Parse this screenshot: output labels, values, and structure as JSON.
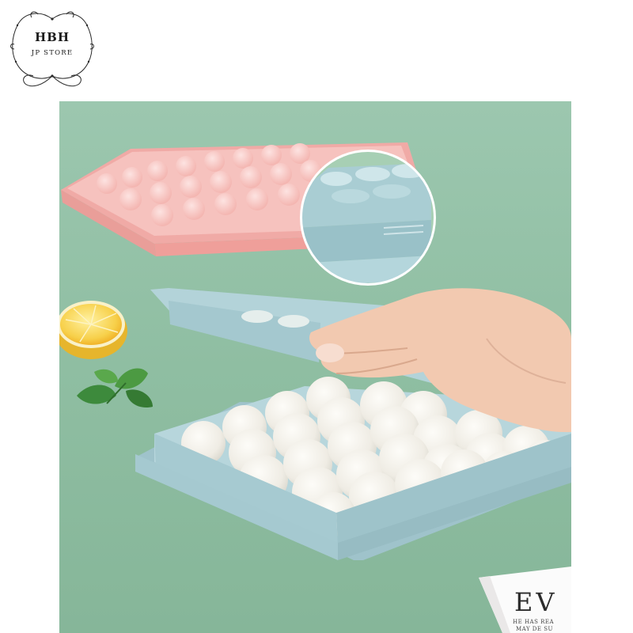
{
  "logo": {
    "main": "HBH",
    "sub": "JP STORE"
  },
  "photo": {
    "card_text": {
      "big": "EV",
      "line1": "HE HAS REA",
      "line2": "MAY DE SU"
    }
  },
  "colors": {
    "background": "#8fbfa4",
    "tray_blue": "#a9ccd4",
    "tray_pink": "#f2b8b4",
    "lemon": "#f6c93a",
    "mint": "#3f8a3a",
    "ice_ball": "#f1efe9"
  }
}
